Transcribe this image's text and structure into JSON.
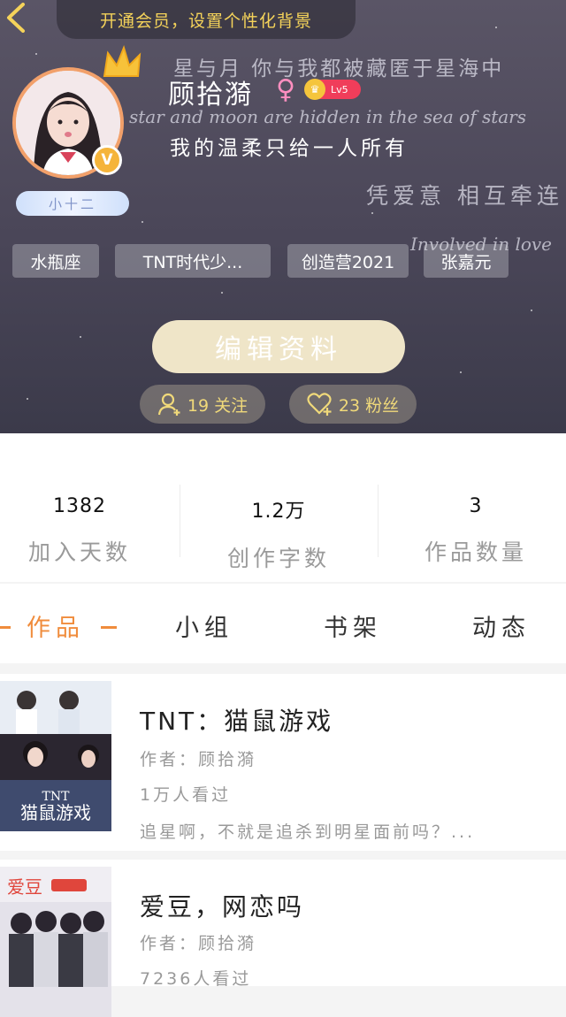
{
  "header": {
    "vip_banner": "开通会员，设置个性化背景",
    "bg_text": {
      "line1": "星与月 你与我都被藏匿于星海中",
      "line2": "star and moon are hidden in the sea of stars",
      "line3": "凭爱意 相互牵连",
      "line4": "Involved in love"
    }
  },
  "profile": {
    "username": "顾拾漪",
    "gender_symbol": "♀",
    "level": "Lv5",
    "vip_mark": "V",
    "nickplate": "小十二",
    "bio": "我的温柔只给一人所有",
    "tags": [
      "水瓶座",
      "TNT时代少...",
      "创造营2021",
      "张嘉元"
    ],
    "edit_button": "编辑资料",
    "following": "19 关注",
    "followers": "23 粉丝"
  },
  "stats": [
    {
      "value": "1382",
      "label": "加入天数"
    },
    {
      "value": "1.2万",
      "label": "创作字数"
    },
    {
      "value": "3",
      "label": "作品数量"
    }
  ],
  "tabs": [
    {
      "label": "作品",
      "active": true
    },
    {
      "label": "小组",
      "active": false
    },
    {
      "label": "书架",
      "active": false
    },
    {
      "label": "动态",
      "active": false
    }
  ],
  "works": [
    {
      "title": "TNT：猫鼠游戏",
      "author": "作者：顾拾漪",
      "views": "1万人看过",
      "summary": "追星啊，不就是追杀到明星面前吗？...",
      "cover_text": "TNT猫鼠游戏"
    },
    {
      "title": "爱豆，网恋吗",
      "author": "作者：顾拾漪",
      "views": "7236人看过",
      "cover_text": "爱豆"
    }
  ],
  "colors": {
    "accent": "#f08c3c",
    "vip_gold": "#f5d35a",
    "edit_button": "#efe5c8"
  }
}
